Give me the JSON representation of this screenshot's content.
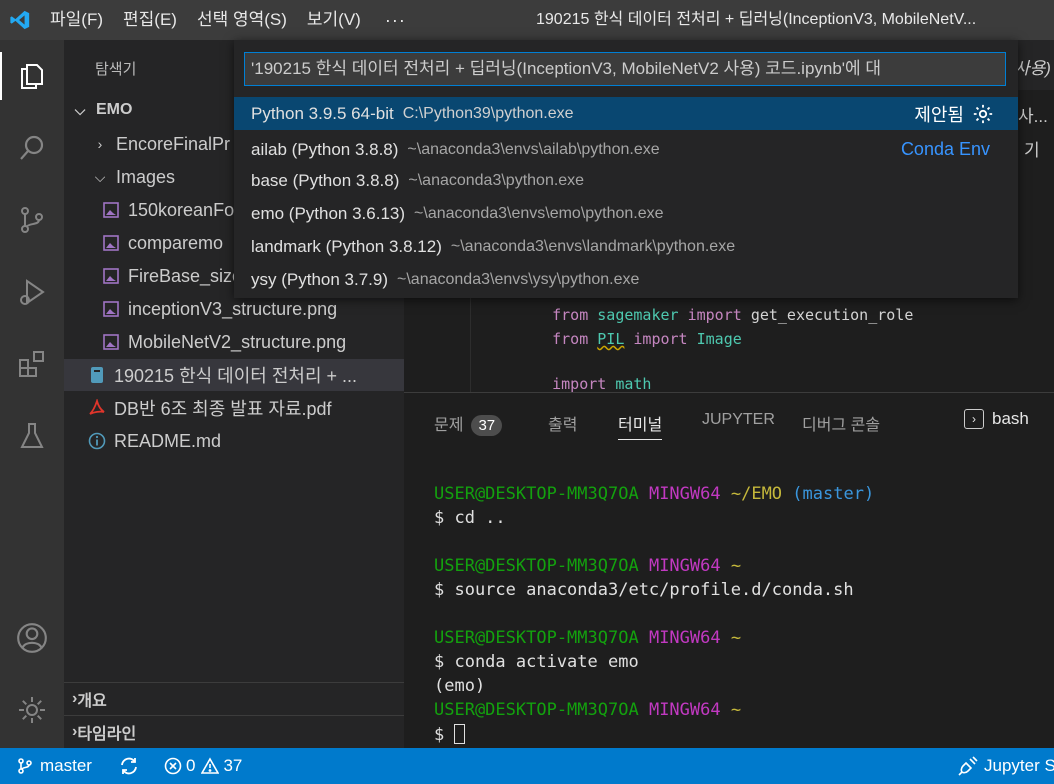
{
  "titlebar": {
    "menus": [
      "파일(F)",
      "편집(E)",
      "선택 영역(S)",
      "보기(V)"
    ],
    "more": "···",
    "window_title": "190215 한식 데이터 전처리 + 딥러닝(InceptionV3, MobileNetV..."
  },
  "sidebar": {
    "title": "탐색기",
    "root": "EMO",
    "items": [
      {
        "label": "EncoreFinalPr",
        "icon": "chevron-right-icon"
      },
      {
        "label": "Images",
        "icon": "chevron-down-icon"
      },
      {
        "label": "150koreanFo",
        "icon": "image-file-icon"
      },
      {
        "label": "comparemo",
        "icon": "image-file-icon"
      },
      {
        "label": "FireBase_size",
        "icon": "image-file-icon"
      },
      {
        "label": "inceptionV3_structure.png",
        "icon": "image-file-icon"
      },
      {
        "label": "MobileNetV2_structure.png",
        "icon": "image-file-icon"
      },
      {
        "label": "190215 한식 데이터 전처리 + ...",
        "icon": "notebook-file-icon"
      },
      {
        "label": "DB반 6조 최종 발표 자료.pdf",
        "icon": "pdf-file-icon"
      },
      {
        "label": "README.md",
        "icon": "info-icon"
      }
    ],
    "outline": "개요",
    "timeline": "타임라인"
  },
  "editor": {
    "tail_line1": "사용) ",
    "tail_line2": "사...",
    "tail_line3": "기",
    "code": [
      {
        "kw": "from",
        "mod": "sagemaker",
        "kw2": "import",
        "rest": "get_execution_role"
      },
      {
        "kw": "from",
        "mod": "PIL",
        "kw2": "import",
        "rest": "Image"
      },
      {
        "kw": "import",
        "mod": "math"
      }
    ]
  },
  "quickpick": {
    "input_value": "'190215 한식 데이터 전처리 + 딥러닝(InceptionV3, MobileNetV2 사용) 코드.ipynb'에 대",
    "options": [
      {
        "label": "Python 3.9.5 64-bit",
        "desc": "C:\\Python39\\python.exe",
        "tag": "제안됨"
      },
      {
        "label": "ailab (Python 3.8.8)",
        "desc": "~\\anaconda3\\envs\\ailab\\python.exe",
        "tag": "Conda Env"
      },
      {
        "label": "base (Python 3.8.8)",
        "desc": "~\\anaconda3\\python.exe"
      },
      {
        "label": "emo (Python 3.6.13)",
        "desc": "~\\anaconda3\\envs\\emo\\python.exe"
      },
      {
        "label": "landmark (Python 3.8.12)",
        "desc": "~\\anaconda3\\envs\\landmark\\python.exe"
      },
      {
        "label": "ysy (Python 3.7.9)",
        "desc": "~\\anaconda3\\envs\\ysy\\python.exe"
      }
    ]
  },
  "panel": {
    "tabs": [
      "문제",
      "출력",
      "터미널",
      "JUPYTER",
      "디버그 콘솔"
    ],
    "problems_count": "37",
    "active_tab": "터미널",
    "shell": "bash",
    "terminal": {
      "prompt_user": "USER@DESKTOP-MM3Q7OA",
      "prompt_host": "MINGW64",
      "lines": [
        {
          "path": "~/EMO",
          "branch": "(master)",
          "cmd": "$ cd .."
        },
        {
          "path": "~",
          "cmd": "$ source anaconda3/etc/profile.d/conda.sh"
        },
        {
          "path": "~",
          "cmd": "$ conda activate emo",
          "out": "(emo)"
        },
        {
          "path": "~",
          "cmd": "$ "
        }
      ]
    }
  },
  "statusbar": {
    "branch": "master",
    "errors": "0",
    "warnings": "37",
    "jupyter": "Jupyter S"
  }
}
